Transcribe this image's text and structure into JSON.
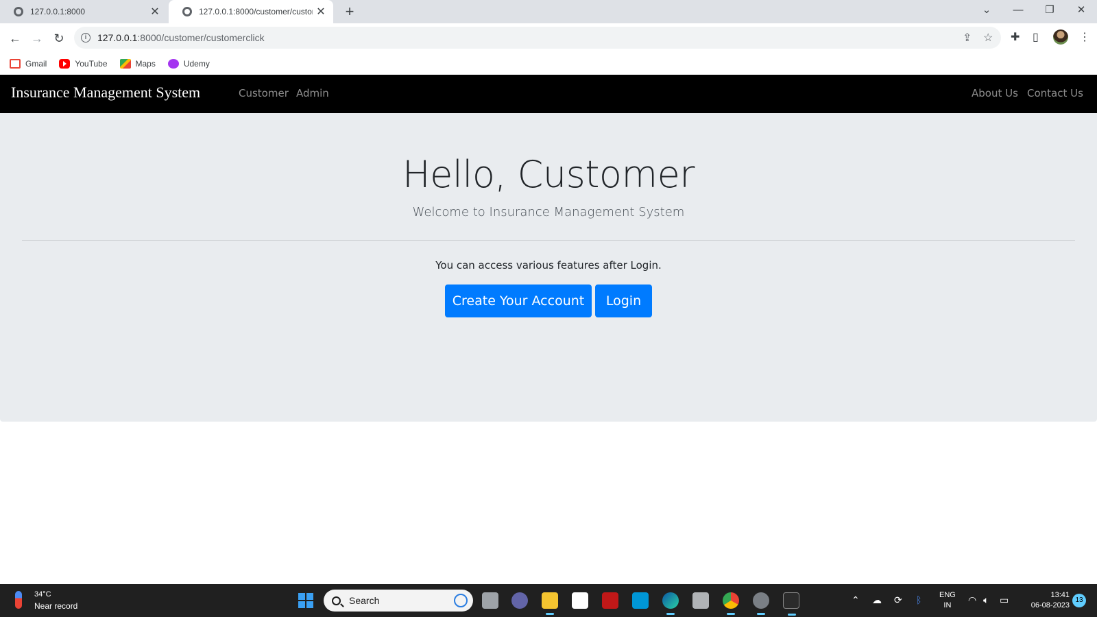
{
  "browser": {
    "tabs": [
      {
        "title": "127.0.0.1:8000",
        "active": false
      },
      {
        "title": "127.0.0.1:8000/customer/custom",
        "active": true
      }
    ],
    "url_host": "127.0.0.1",
    "url_rest": ":8000/customer/customerclick",
    "bookmarks": [
      "Gmail",
      "YouTube",
      "Maps",
      "Udemy"
    ]
  },
  "site": {
    "brand": "Insurance Management System",
    "nav_left": [
      "Customer",
      "Admin"
    ],
    "nav_right": [
      "About Us",
      "Contact Us"
    ]
  },
  "main": {
    "heading": "Hello, Customer",
    "lead": "Welcome to Insurance Management System",
    "access_text": "You can access various features after Login.",
    "create_button": "Create Your Account",
    "login_button": "Login",
    "button_color": "#007bff"
  },
  "taskbar": {
    "temperature": "34°C",
    "weather": "Near record",
    "search_placeholder": "Search",
    "language_line1": "ENG",
    "language_line2": "IN",
    "time": "13:41",
    "date": "06-08-2023",
    "notification_count": "13"
  }
}
